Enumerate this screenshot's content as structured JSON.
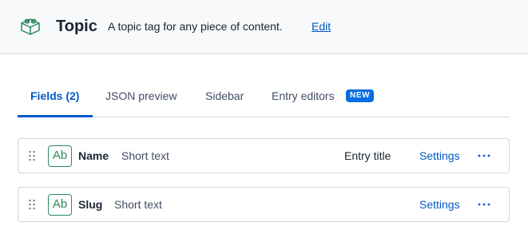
{
  "header": {
    "title": "Topic",
    "description": "A topic tag for any piece of content.",
    "edit_label": "Edit",
    "logo_icon": "lego-block-icon",
    "accent_color": "#2d8a5e"
  },
  "tabs": [
    {
      "label": "Fields (2)",
      "active": true
    },
    {
      "label": "JSON preview",
      "active": false
    },
    {
      "label": "Sidebar",
      "active": false
    },
    {
      "label": "Entry editors",
      "active": false,
      "badge": "NEW"
    }
  ],
  "fields": [
    {
      "type_icon_label": "Ab",
      "name": "Name",
      "type": "Short text",
      "meta": "Entry title",
      "settings_label": "Settings",
      "more_icon": "more-horizontal-icon"
    },
    {
      "type_icon_label": "Ab",
      "name": "Slug",
      "type": "Short text",
      "meta": "",
      "settings_label": "Settings",
      "more_icon": "more-horizontal-icon"
    }
  ],
  "colors": {
    "primary": "#0059c8",
    "badge": "#036fe3",
    "header_bg": "#f7f9fa"
  }
}
